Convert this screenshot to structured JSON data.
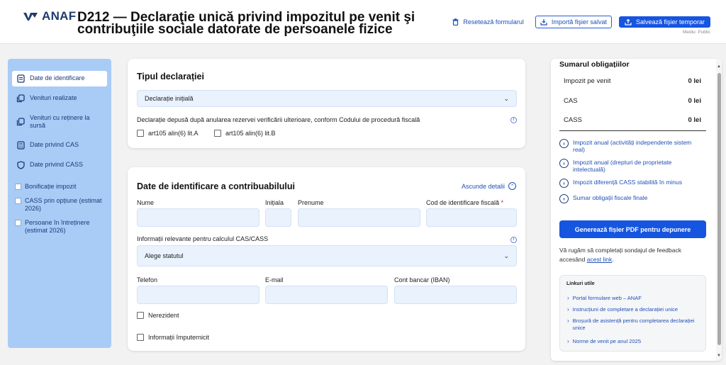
{
  "header": {
    "logo_text": "ANAF",
    "title": "D212 — Declaraţie unică privind impozitul pe venit şi contribuţiile sociale datorate de persoanele fizice",
    "reset_label": "Resetează formularul",
    "import_label": "Importă fişier salvat",
    "save_label": "Salvează fişier temporar",
    "environment": "Mediu: Public"
  },
  "sidebar": {
    "items": [
      {
        "label": "Date de identificare",
        "icon": "document-icon",
        "active": true
      },
      {
        "label": "Venituri realizate",
        "icon": "copy-icon"
      },
      {
        "label": "Venituri cu reținere la sursă",
        "icon": "copy-icon"
      },
      {
        "label": "Date privind CAS",
        "icon": "calculator-icon"
      },
      {
        "label": "Date privind CASS",
        "icon": "shield-icon"
      }
    ],
    "checks": [
      {
        "label": "Bonificație impozit"
      },
      {
        "label": "CASS prin opțiune (estimat 2026)"
      },
      {
        "label": "Persoane în întreținere (estimat 2026)"
      }
    ]
  },
  "declaration_type": {
    "title": "Tipul declarației",
    "selected": "Declarație inițială",
    "note": "Declarație depusă după anularea rezervei verificării ulterioare, conform Codului de procedură fiscală",
    "option_a": "art105 alin(6) lit.A",
    "option_b": "art105 alin(6) lit.B"
  },
  "identification": {
    "title": "Date de identificare a contribuabilului",
    "toggle_label": "Ascunde detalii",
    "nume_label": "Nume",
    "initiala_label": "Inițiala",
    "prenume_label": "Prenume",
    "cod_label": "Cod de identificare fiscală",
    "required_mark": "*",
    "cas_info_label": "Informații relevante pentru calculul CAS/CASS",
    "status_placeholder": "Alege statutul",
    "telefon_label": "Telefon",
    "email_label": "E-mail",
    "iban_label": "Cont bancar (IBAN)",
    "nerezident_label": "Nerezident",
    "imputernicit_label": "Informații împuternicit"
  },
  "summary": {
    "title": "Sumarul obligațiilor",
    "rows": [
      {
        "label": "Impozit pe venit",
        "value": "0 lei"
      },
      {
        "label": "CAS",
        "value": "0 lei"
      },
      {
        "label": "CASS",
        "value": "0 lei"
      }
    ],
    "links": [
      "Impozit anual (activități independente sistem real)",
      "Impozit anual (drepturi de proprietate intelectuală)",
      "Impozit diferență CASS stabilită în minus",
      "Sumar obligații fiscale finale"
    ],
    "generate_label": "Generează fișier PDF pentru depunere",
    "feedback_text": "Vă rugăm să completați sondajul de feedback accesând",
    "feedback_link": "acest link",
    "feedback_end": ".",
    "useful_title": "Linkuri utile",
    "useful_links": [
      "Portal formulare web – ANAF",
      "Instrucțiuni de completare a declarației unice",
      "Broșură de asistență pentru completarea declarației unice",
      "Norme de venit pe anul 2025"
    ]
  },
  "colors": {
    "brand": "#1f3a6d",
    "primary": "#1655e0",
    "sidebar_bg": "#a9ccf7",
    "input_bg": "#e9f2fd"
  }
}
